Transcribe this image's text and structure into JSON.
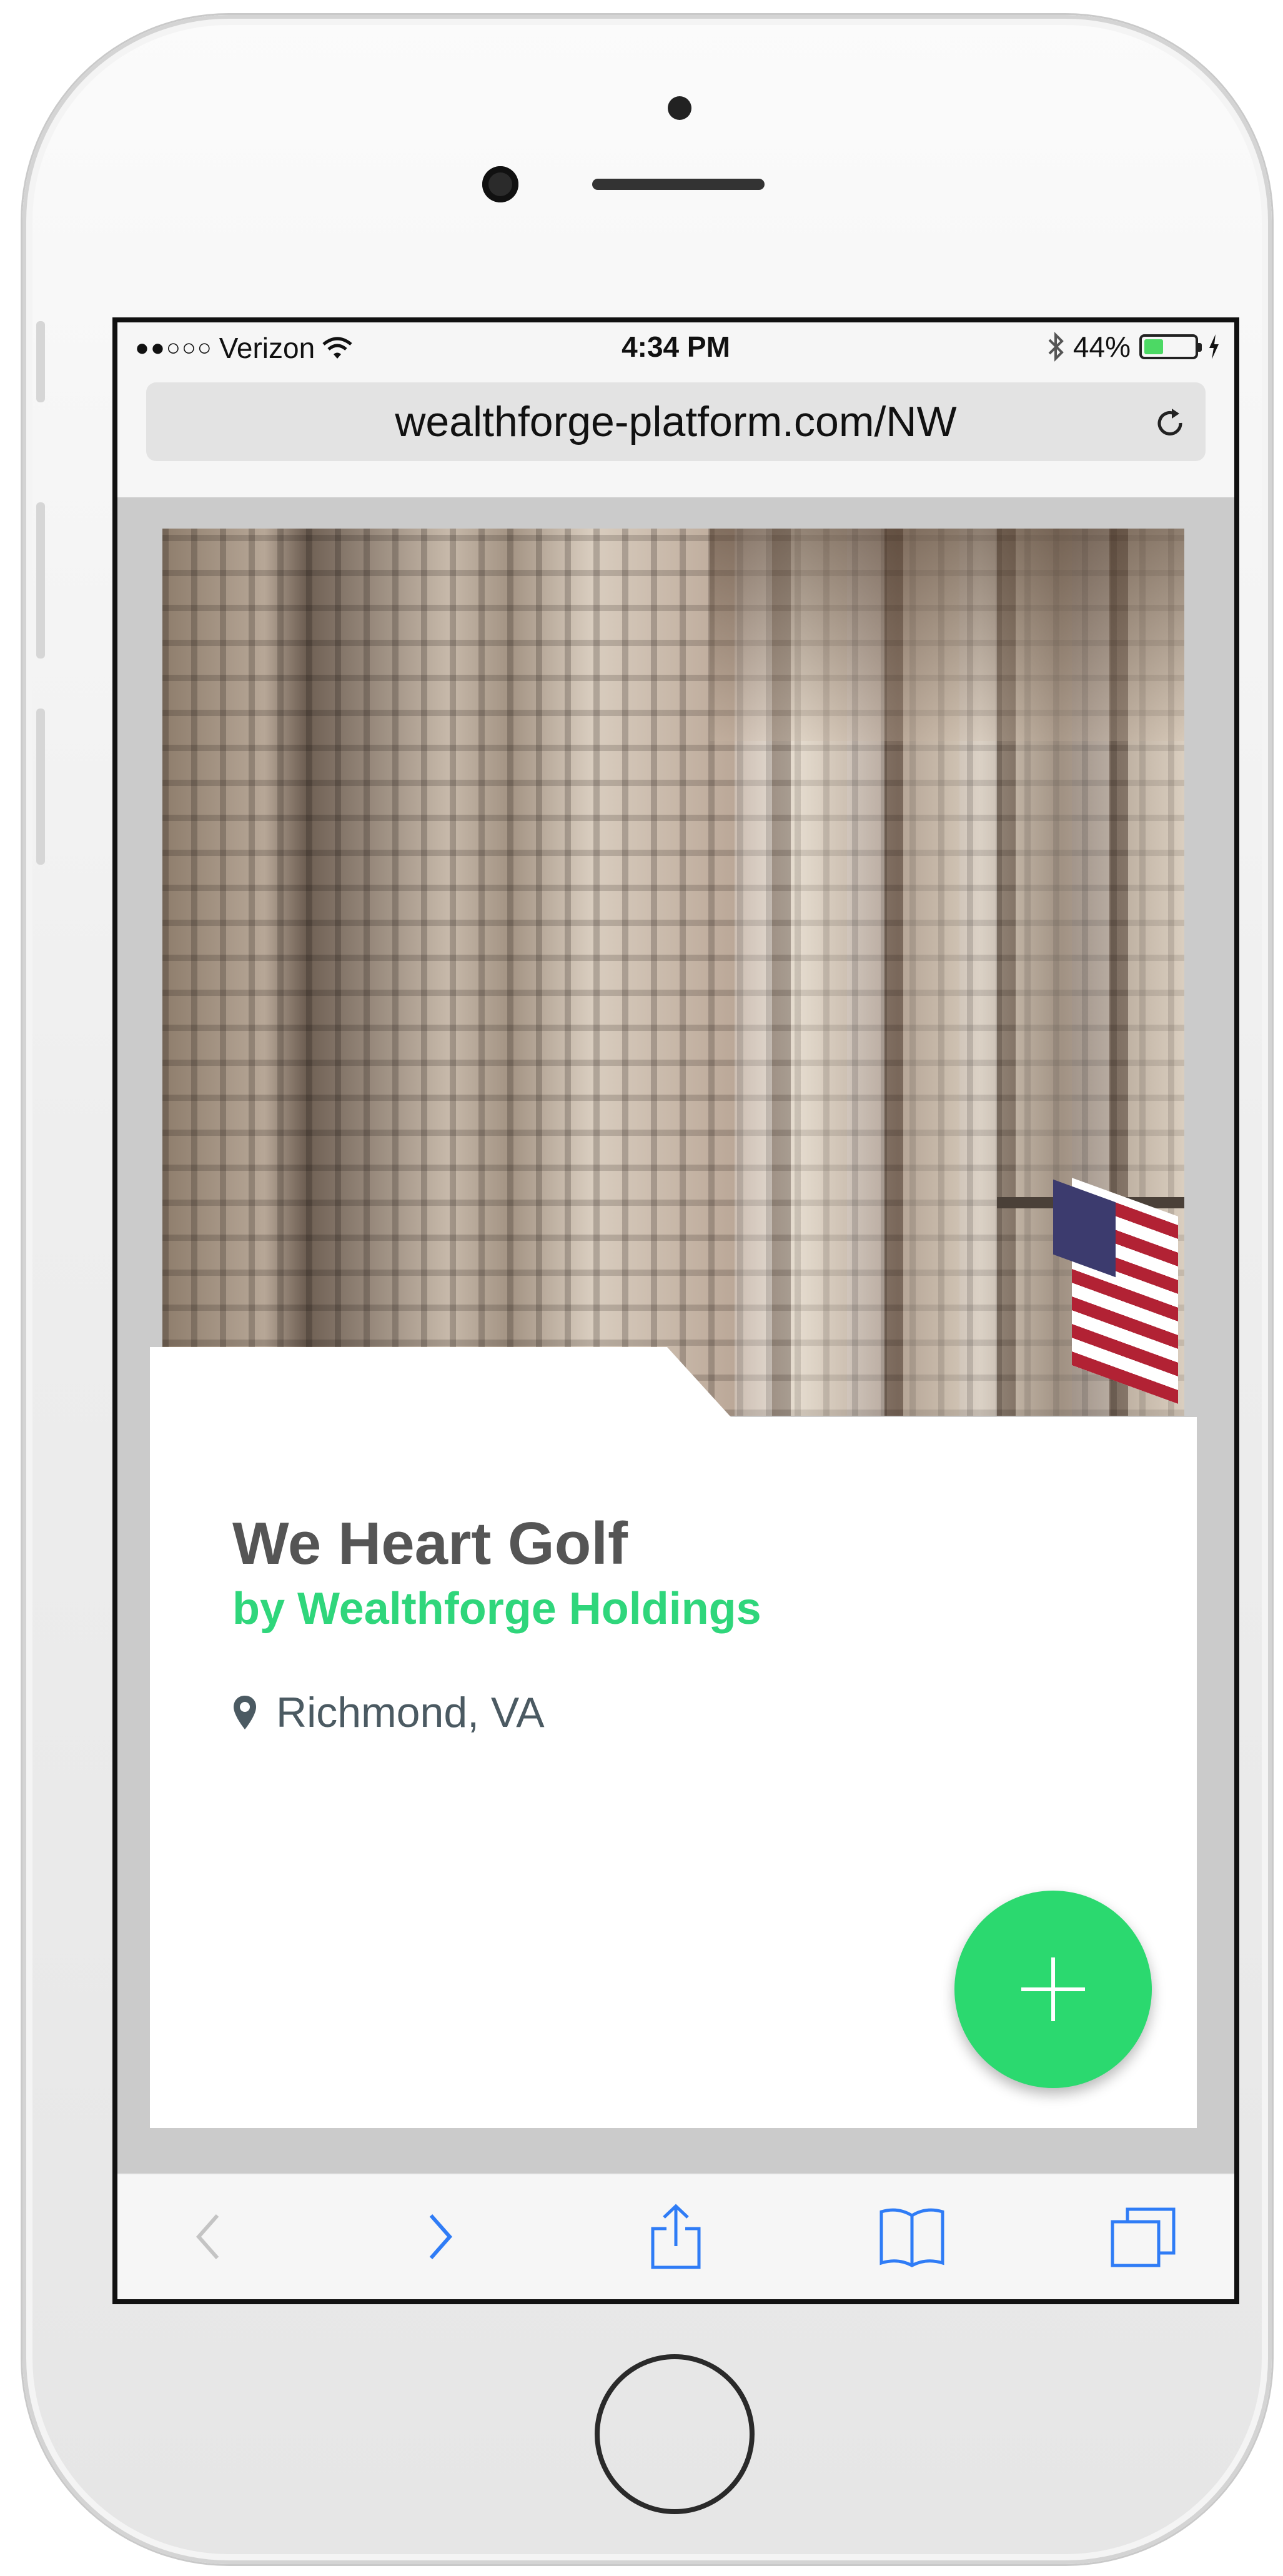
{
  "status_bar": {
    "signal_dots": "●●○○○",
    "carrier": "Verizon",
    "time": "4:34 PM",
    "battery_percent": "44%",
    "battery_level": 0.44
  },
  "browser": {
    "url": "wealthforge-platform.com/NW"
  },
  "card": {
    "title": "We Heart Golf",
    "subtitle": "by Wealthforge Holdings",
    "location": "Richmond, VA"
  },
  "colors": {
    "accent_green": "#2bd96f",
    "subtitle_green": "#2fd67b",
    "safari_blue": "#2f7cf6"
  },
  "icons": {
    "location": "map-pin-icon",
    "fab": "plus-icon",
    "reload": "reload-icon",
    "back": "chevron-left-icon",
    "forward": "chevron-right-icon",
    "share": "share-icon",
    "bookmarks": "book-icon",
    "tabs": "tabs-icon"
  }
}
